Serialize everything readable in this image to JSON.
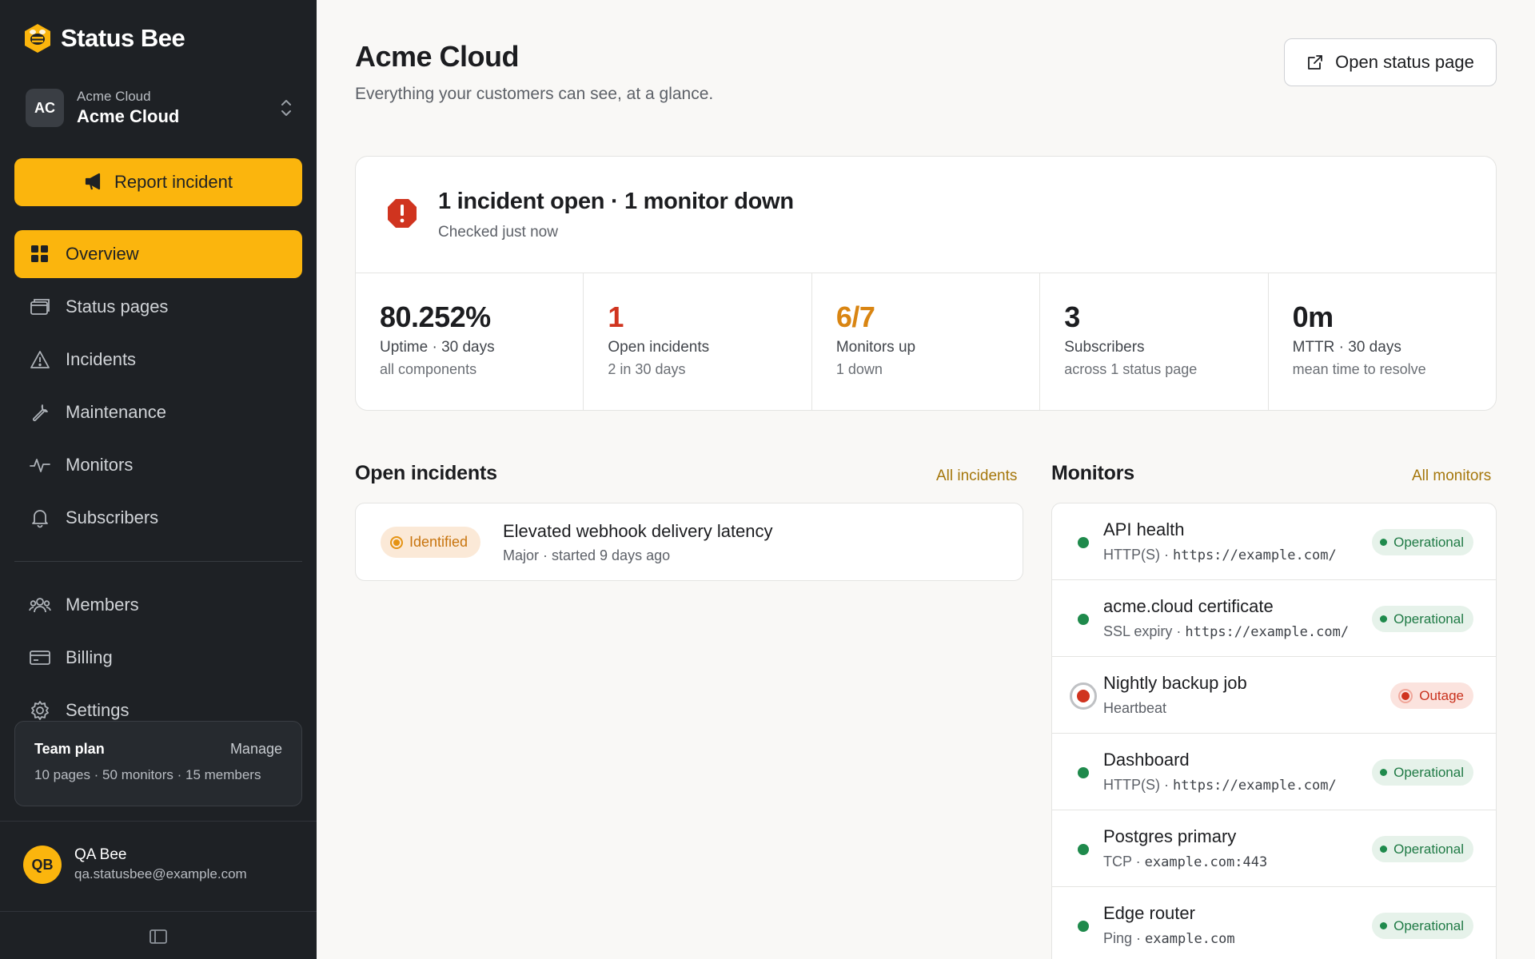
{
  "brand": {
    "name": "Status Bee",
    "logo_icon": "bee-icon"
  },
  "org": {
    "initials": "AC",
    "label": "Acme Cloud",
    "name": "Acme Cloud"
  },
  "sidebar": {
    "report_label": "Report incident",
    "nav": [
      {
        "label": "Overview",
        "icon": "grid-icon",
        "active": true
      },
      {
        "label": "Status pages",
        "icon": "pages-icon"
      },
      {
        "label": "Incidents",
        "icon": "warning-icon"
      },
      {
        "label": "Maintenance",
        "icon": "wrench-icon"
      },
      {
        "label": "Monitors",
        "icon": "pulse-icon"
      },
      {
        "label": "Subscribers",
        "icon": "bell-icon"
      }
    ],
    "secondary_nav": [
      {
        "label": "Members",
        "icon": "users-icon"
      },
      {
        "label": "Billing",
        "icon": "credit-card-icon"
      },
      {
        "label": "Settings",
        "icon": "gear-icon"
      }
    ],
    "plan": {
      "name": "Team plan",
      "manage": "Manage",
      "limits": "10 pages · 50 monitors · 15 members"
    },
    "user": {
      "initials": "QB",
      "name": "QA Bee",
      "email": "qa.statusbee@example.com"
    }
  },
  "header": {
    "title": "Acme Cloud",
    "subtitle": "Everything your customers can see, at a glance.",
    "open_status_page": "Open status page"
  },
  "summary": {
    "title": "1 incident open · 1 monitor down",
    "checked": "Checked just now",
    "stats": [
      {
        "value": "80.252%",
        "label": "Uptime · 30 days",
        "sub": "all components",
        "tone": "default"
      },
      {
        "value": "1",
        "label": "Open incidents",
        "sub": "2 in 30 days",
        "tone": "red"
      },
      {
        "value": "6/7",
        "label": "Monitors up",
        "sub": "1 down",
        "tone": "orange"
      },
      {
        "value": "3",
        "label": "Subscribers",
        "sub": "across 1 status page",
        "tone": "default"
      },
      {
        "value": "0m",
        "label": "MTTR · 30 days",
        "sub": "mean time to resolve",
        "tone": "default"
      }
    ]
  },
  "open_incidents": {
    "title": "Open incidents",
    "link": "All incidents",
    "items": [
      {
        "status": "Identified",
        "title": "Elevated webhook delivery latency",
        "meta": "Major · started 9 days ago"
      }
    ]
  },
  "monitors": {
    "title": "Monitors",
    "link": "All monitors",
    "items": [
      {
        "name": "API health",
        "type": "HTTP(S) · ",
        "target": "https://example.com/",
        "status": "Operational",
        "state": "ok"
      },
      {
        "name": "acme.cloud certificate",
        "type": "SSL expiry · ",
        "target": "https://example.com/",
        "status": "Operational",
        "state": "ok"
      },
      {
        "name": "Nightly backup job",
        "type": "Heartbeat",
        "target": "",
        "status": "Outage",
        "state": "bad"
      },
      {
        "name": "Dashboard",
        "type": "HTTP(S) · ",
        "target": "https://example.com/",
        "status": "Operational",
        "state": "ok"
      },
      {
        "name": "Postgres primary",
        "type": "TCP · ",
        "target": "example.com:443",
        "status": "Operational",
        "state": "ok"
      },
      {
        "name": "Edge router",
        "type": "Ping · ",
        "target": "example.com",
        "status": "Operational",
        "state": "ok"
      }
    ]
  },
  "colors": {
    "accent": "#fbb50d",
    "sidebar_bg": "#1e2125",
    "danger": "#d0341f",
    "warning": "#d98512",
    "success": "#1f8a4c"
  }
}
